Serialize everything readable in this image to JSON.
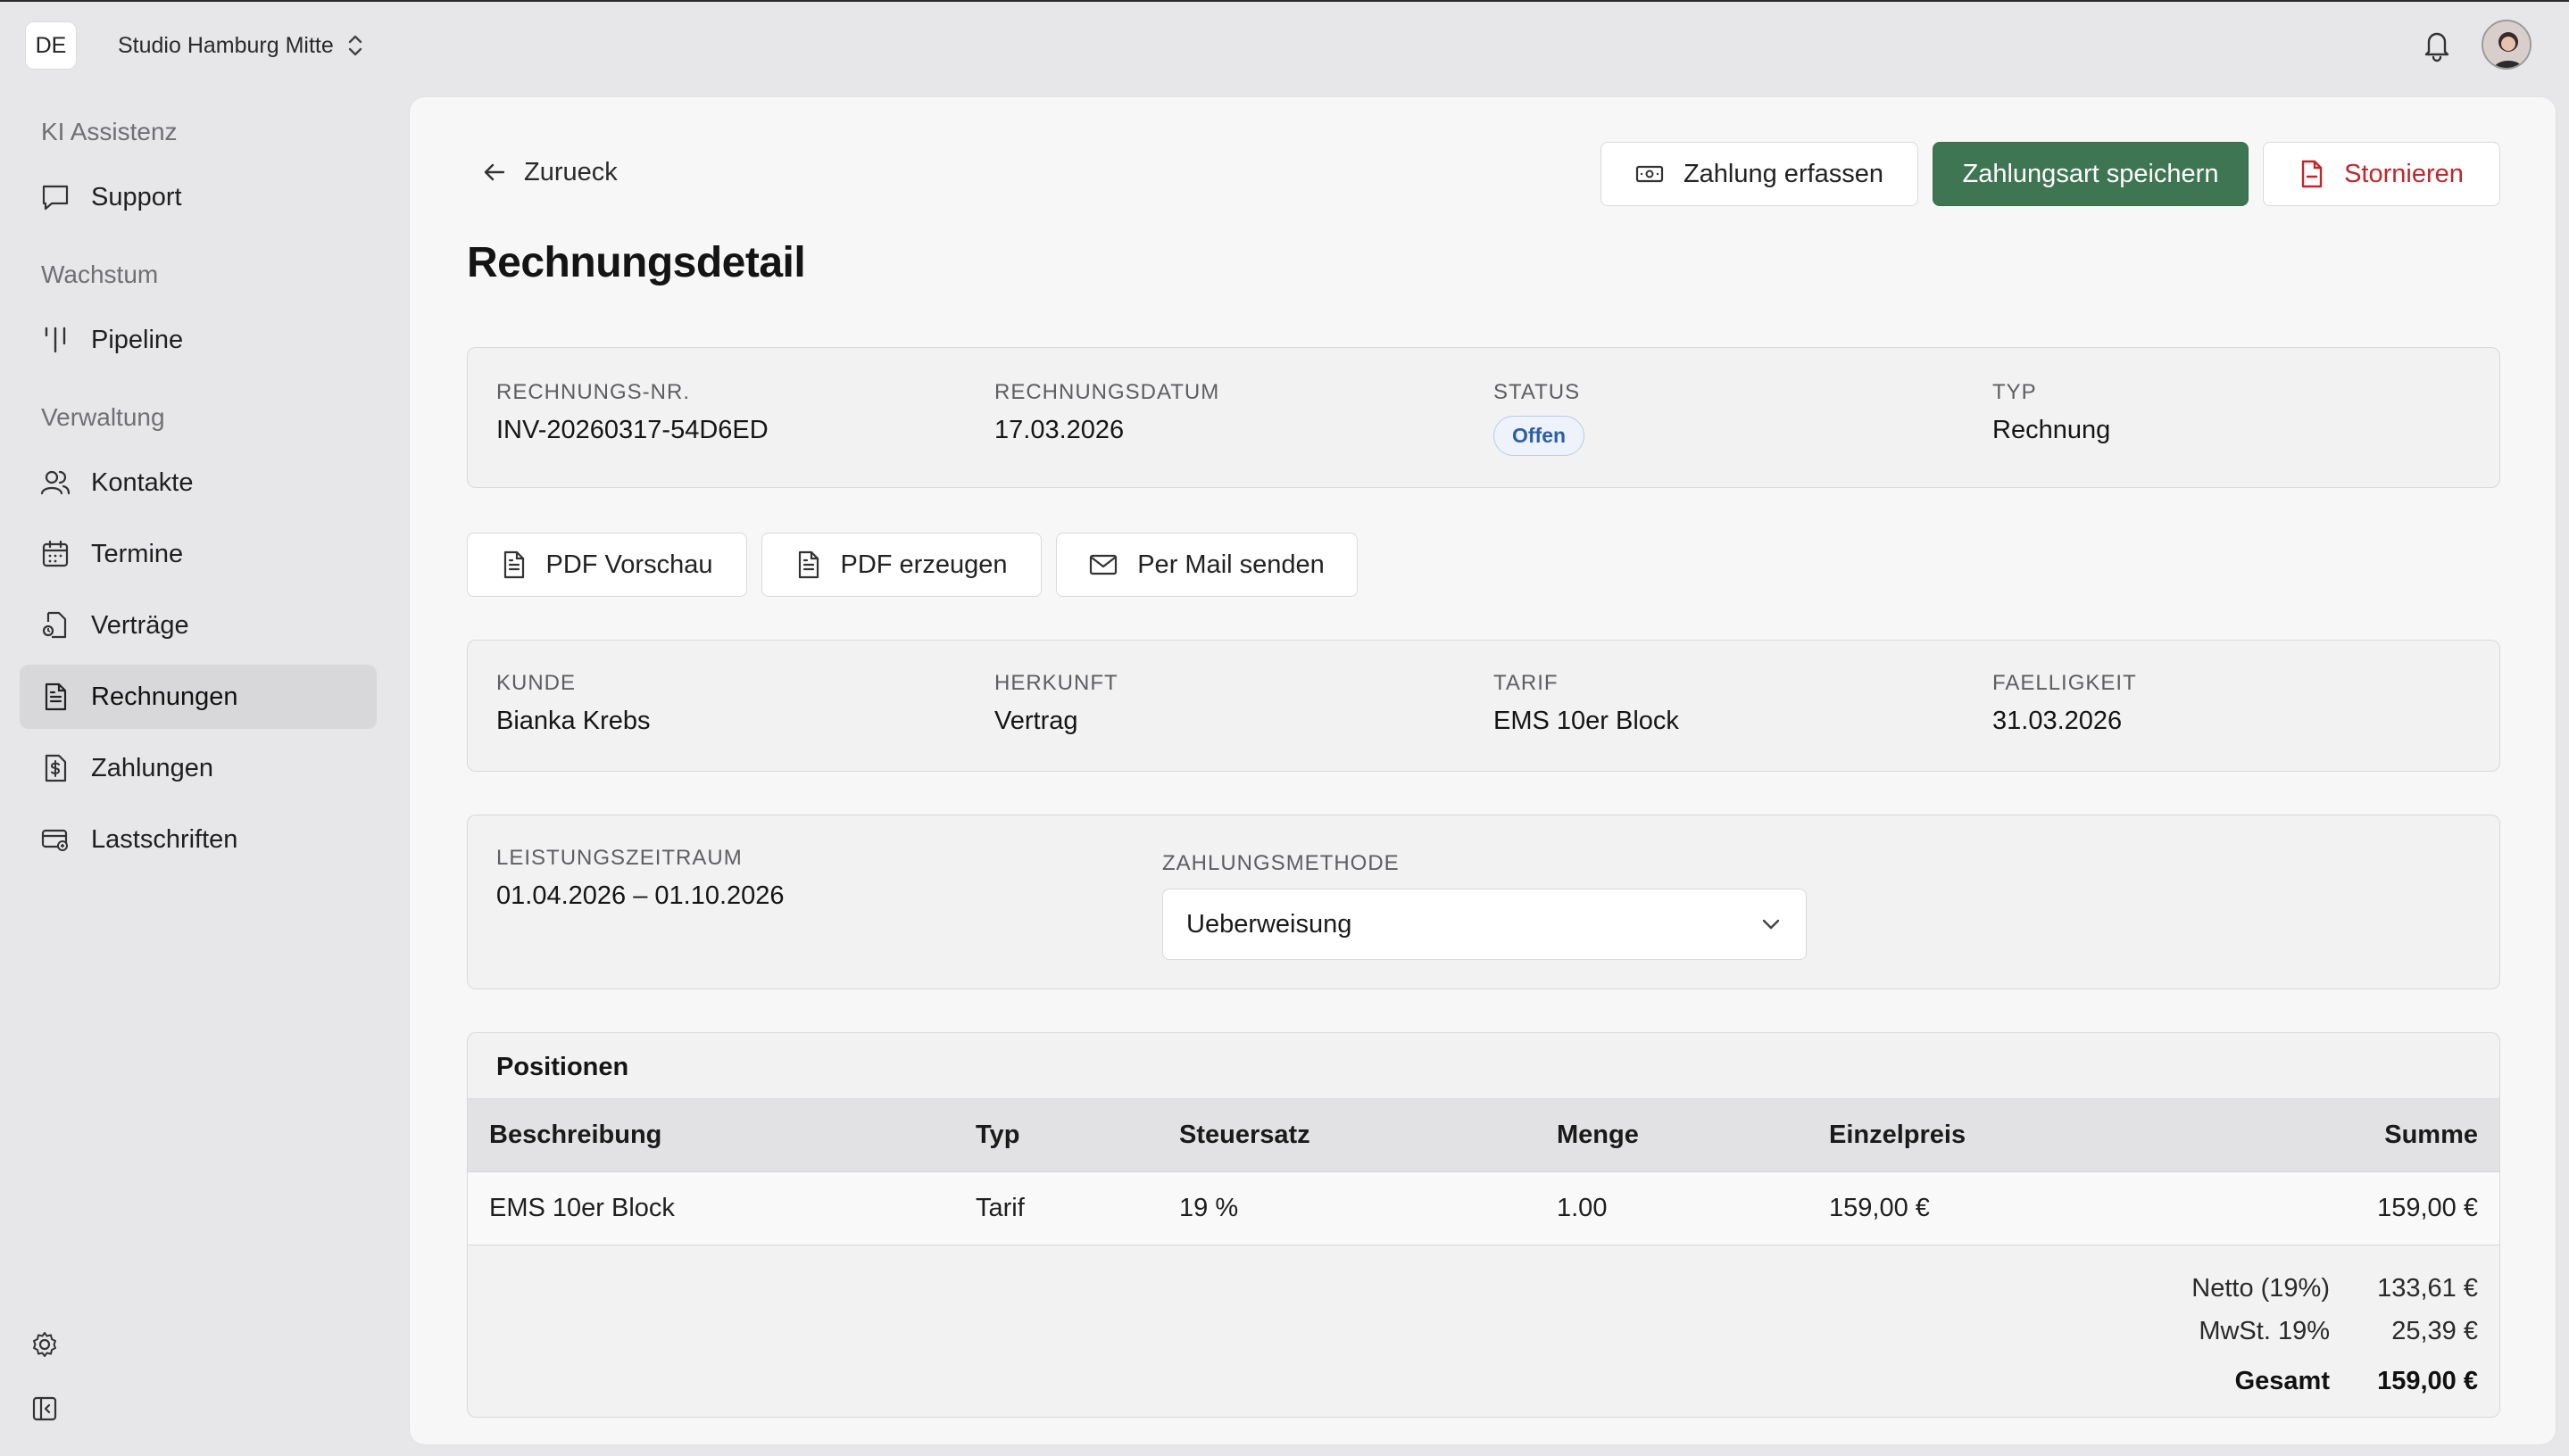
{
  "topbar": {
    "lang": "DE",
    "studio": "Studio Hamburg Mitte"
  },
  "sidebar": {
    "sections": [
      {
        "title": "KI Assistenz",
        "items": [
          {
            "label": "Support",
            "icon": "chat-icon"
          }
        ]
      },
      {
        "title": "Wachstum",
        "items": [
          {
            "label": "Pipeline",
            "icon": "pipeline-icon"
          }
        ]
      },
      {
        "title": "Verwaltung",
        "items": [
          {
            "label": "Kontakte",
            "icon": "users-icon"
          },
          {
            "label": "Termine",
            "icon": "calendar-icon"
          },
          {
            "label": "Verträge",
            "icon": "contract-icon"
          },
          {
            "label": "Rechnungen",
            "icon": "invoice-icon",
            "active": true
          },
          {
            "label": "Zahlungen",
            "icon": "payments-icon"
          },
          {
            "label": "Lastschriften",
            "icon": "direct-debit-icon"
          }
        ]
      }
    ]
  },
  "page": {
    "back": "Zurueck",
    "title": "Rechnungsdetail",
    "actions": {
      "record_payment": "Zahlung erfassen",
      "save_method": "Zahlungsart speichern",
      "cancel": "Stornieren"
    }
  },
  "invoice": {
    "number_label": "RECHNUNGS-NR.",
    "number": "INV-20260317-54D6ED",
    "date_label": "RECHNUNGSDATUM",
    "date": "17.03.2026",
    "status_label": "STATUS",
    "status": "Offen",
    "type_label": "TYP",
    "type": "Rechnung"
  },
  "doc_actions": {
    "pdf_preview": "PDF Vorschau",
    "pdf_generate": "PDF erzeugen",
    "send_mail": "Per Mail senden"
  },
  "customer": {
    "customer_label": "KUNDE",
    "customer": "Bianka Krebs",
    "origin_label": "HERKUNFT",
    "origin": "Vertrag",
    "tariff_label": "TARIF",
    "tariff": "EMS 10er Block",
    "due_label": "FAELLIGKEIT",
    "due": "31.03.2026"
  },
  "service": {
    "period_label": "LEISTUNGSZEITRAUM",
    "period": "01.04.2026 – 01.10.2026",
    "method_label": "ZAHLUNGSMETHODE",
    "method": "Ueberweisung"
  },
  "positions": {
    "title": "Positionen",
    "columns": [
      "Beschreibung",
      "Typ",
      "Steuersatz",
      "Menge",
      "Einzelpreis",
      "Summe"
    ],
    "rows": [
      [
        "EMS 10er Block",
        "Tarif",
        "19 %",
        "1.00",
        "159,00 €",
        "159,00 €"
      ]
    ],
    "totals": {
      "net_label": "Netto (19%)",
      "net": "133,61 €",
      "vat_label": "MwSt. 19%",
      "vat": "25,39 €",
      "total_label": "Gesamt",
      "total": "159,00 €"
    }
  },
  "colors": {
    "primary": "#3e7552",
    "danger": "#c0262a",
    "status_badge": "#2d5ea8"
  }
}
